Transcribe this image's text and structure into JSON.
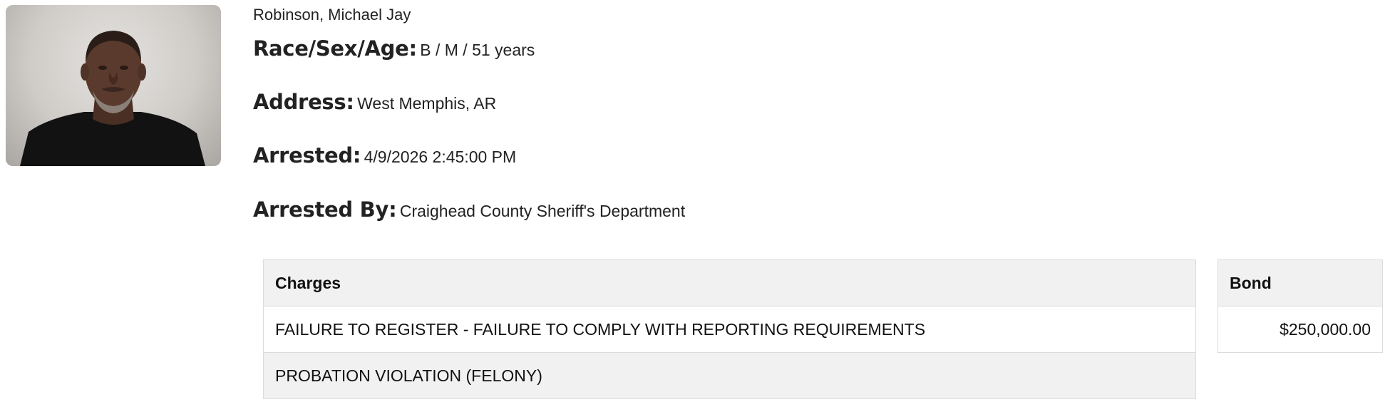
{
  "person": {
    "name": "Robinson, Michael Jay",
    "photo_icon": "mugshot-photo"
  },
  "fields": {
    "race_sex_age_label": "Race/Sex/Age:",
    "race_sex_age_value": "B / M / 51 years",
    "address_label": "Address:",
    "address_value": "West Memphis, AR",
    "arrested_label": "Arrested:",
    "arrested_value": "4/9/2026 2:45:00 PM",
    "arrested_by_label": "Arrested By:",
    "arrested_by_value": "Craighead County Sheriff's Department"
  },
  "charges": {
    "header": "Charges",
    "rows": [
      "FAILURE TO REGISTER - FAILURE TO COMPLY WITH REPORTING REQUIREMENTS",
      "PROBATION VIOLATION (FELONY)"
    ]
  },
  "bond": {
    "header": "Bond",
    "rows": [
      "$250,000.00"
    ]
  }
}
